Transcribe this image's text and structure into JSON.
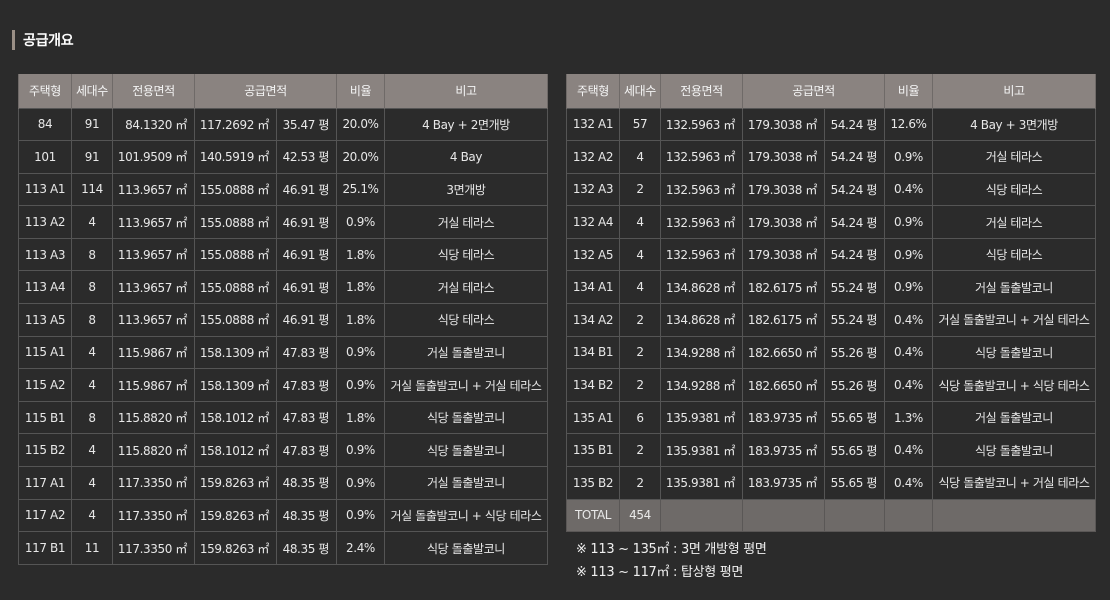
{
  "title": "공급개요",
  "columns": [
    "주택형",
    "세대수",
    "전용면적",
    "공급면적",
    "비율",
    "비고"
  ],
  "left_rows": [
    [
      "84",
      "91",
      "84.1320 ㎡",
      "117.2692 ㎡",
      "35.47 평",
      "20.0%",
      "4 Bay + 2면개방"
    ],
    [
      "101",
      "91",
      "101.9509 ㎡",
      "140.5919 ㎡",
      "42.53 평",
      "20.0%",
      "4 Bay"
    ],
    [
      "113 A1",
      "114",
      "113.9657 ㎡",
      "155.0888 ㎡",
      "46.91 평",
      "25.1%",
      "3면개방"
    ],
    [
      "113 A2",
      "4",
      "113.9657 ㎡",
      "155.0888 ㎡",
      "46.91 평",
      "0.9%",
      "거실 테라스"
    ],
    [
      "113 A3",
      "8",
      "113.9657 ㎡",
      "155.0888 ㎡",
      "46.91 평",
      "1.8%",
      "식당 테라스"
    ],
    [
      "113 A4",
      "8",
      "113.9657 ㎡",
      "155.0888 ㎡",
      "46.91 평",
      "1.8%",
      "거실 테라스"
    ],
    [
      "113 A5",
      "8",
      "113.9657 ㎡",
      "155.0888 ㎡",
      "46.91 평",
      "1.8%",
      "식당 테라스"
    ],
    [
      "115 A1",
      "4",
      "115.9867 ㎡",
      "158.1309 ㎡",
      "47.83 평",
      "0.9%",
      "거실 돌출발코니"
    ],
    [
      "115 A2",
      "4",
      "115.9867 ㎡",
      "158.1309 ㎡",
      "47.83 평",
      "0.9%",
      "거실 돌출발코니 + 거실 테라스"
    ],
    [
      "115 B1",
      "8",
      "115.8820 ㎡",
      "158.1012 ㎡",
      "47.83 평",
      "1.8%",
      "식당 돌출발코니"
    ],
    [
      "115 B2",
      "4",
      "115.8820 ㎡",
      "158.1012 ㎡",
      "47.83 평",
      "0.9%",
      "식당 돌출발코니"
    ],
    [
      "117 A1",
      "4",
      "117.3350 ㎡",
      "159.8263 ㎡",
      "48.35 평",
      "0.9%",
      "거실 돌출발코니"
    ],
    [
      "117 A2",
      "4",
      "117.3350 ㎡",
      "159.8263 ㎡",
      "48.35 평",
      "0.9%",
      "거실 돌출발코니 + 식당 테라스"
    ],
    [
      "117 B1",
      "11",
      "117.3350 ㎡",
      "159.8263 ㎡",
      "48.35 평",
      "2.4%",
      "식당 돌출발코니"
    ]
  ],
  "right_rows": [
    [
      "132 A1",
      "57",
      "132.5963 ㎡",
      "179.3038 ㎡",
      "54.24 평",
      "12.6%",
      "4 Bay + 3면개방"
    ],
    [
      "132 A2",
      "4",
      "132.5963 ㎡",
      "179.3038 ㎡",
      "54.24 평",
      "0.9%",
      "거실 테라스"
    ],
    [
      "132 A3",
      "2",
      "132.5963 ㎡",
      "179.3038 ㎡",
      "54.24 평",
      "0.4%",
      "식당 테라스"
    ],
    [
      "132 A4",
      "4",
      "132.5963 ㎡",
      "179.3038 ㎡",
      "54.24 평",
      "0.9%",
      "거실 테라스"
    ],
    [
      "132 A5",
      "4",
      "132.5963 ㎡",
      "179.3038 ㎡",
      "54.24 평",
      "0.9%",
      "식당 테라스"
    ],
    [
      "134 A1",
      "4",
      "134.8628 ㎡",
      "182.6175 ㎡",
      "55.24 평",
      "0.9%",
      "거실 돌출발코니"
    ],
    [
      "134 A2",
      "2",
      "134.8628 ㎡",
      "182.6175 ㎡",
      "55.24 평",
      "0.4%",
      "거실 돌출발코니 + 거실 테라스"
    ],
    [
      "134 B1",
      "2",
      "134.9288 ㎡",
      "182.6650 ㎡",
      "55.26 평",
      "0.4%",
      "식당 돌출발코니"
    ],
    [
      "134 B2",
      "2",
      "134.9288 ㎡",
      "182.6650 ㎡",
      "55.26 평",
      "0.4%",
      "식당 돌출발코니 + 식당 테라스"
    ],
    [
      "135 A1",
      "6",
      "135.9381 ㎡",
      "183.9735 ㎡",
      "55.65 평",
      "1.3%",
      "거실 돌출발코니"
    ],
    [
      "135 B1",
      "2",
      "135.9381 ㎡",
      "183.9735 ㎡",
      "55.65 평",
      "0.4%",
      "식당 돌출발코니"
    ],
    [
      "135 B2",
      "2",
      "135.9381 ㎡",
      "183.9735 ㎡",
      "55.65 평",
      "0.4%",
      "식당 돌출발코니 + 거실 테라스"
    ]
  ],
  "total": {
    "label": "TOTAL",
    "count": "454"
  },
  "notes": [
    "※ 113 ~ 135㎡ : 3면 개방형 평면",
    "※ 113 ~ 117㎡ : 탑상형 평면"
  ]
}
